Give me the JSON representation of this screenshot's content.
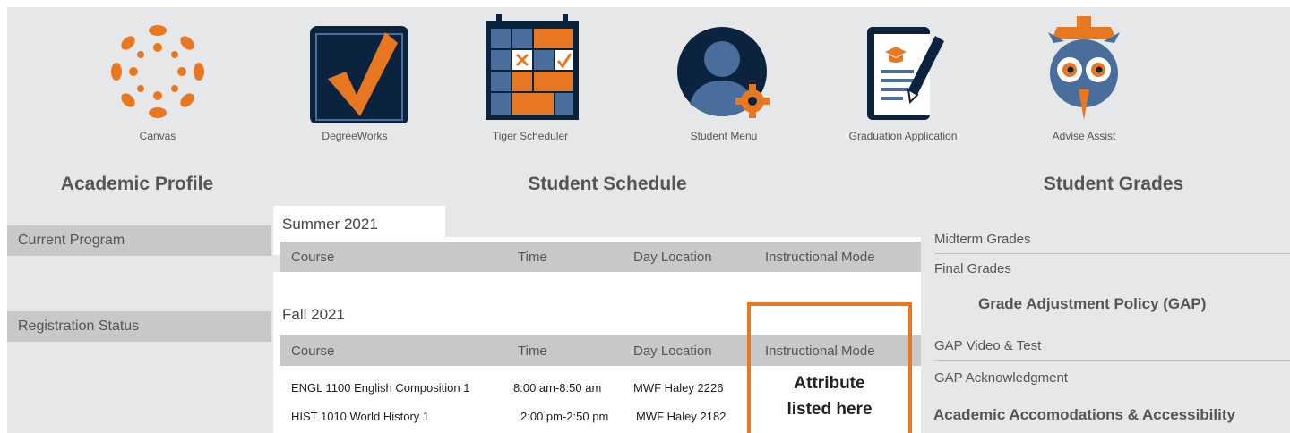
{
  "apps": [
    {
      "label": "Canvas",
      "icon": "canvas-icon"
    },
    {
      "label": "DegreeWorks",
      "icon": "degreeworks-checkmark-icon"
    },
    {
      "label": "Tiger Scheduler",
      "icon": "calendar-scheduler-icon"
    },
    {
      "label": "Student Menu",
      "icon": "student-gear-icon"
    },
    {
      "label": "Graduation Application",
      "icon": "graduation-document-icon"
    },
    {
      "label": "Advise Assist",
      "icon": "owl-icon"
    }
  ],
  "academic_profile": {
    "title": "Academic Profile",
    "items": [
      "Current Program",
      "Registration Status"
    ]
  },
  "schedule": {
    "title": "Student Schedule",
    "columns": [
      "Course",
      "Time",
      "Day Location",
      "Instructional Mode"
    ],
    "terms": [
      {
        "name": "Summer 2021",
        "courses": []
      },
      {
        "name": "Fall 2021",
        "courses": [
          {
            "course": "ENGL 1100 English Composition 1",
            "time": "8:00 am-8:50 am",
            "day_location": "MWF Haley 2226"
          },
          {
            "course": "HIST 1010 World History 1",
            "time": "2:00 pm-2:50 pm",
            "day_location": "MWF Haley 2182"
          }
        ]
      }
    ],
    "callout_line1": "Attribute",
    "callout_line2": "listed here"
  },
  "grades": {
    "title": "Student Grades",
    "links": [
      "Midterm Grades",
      "Final Grades"
    ],
    "gap_title": "Grade Adjustment Policy (GAP)",
    "gap_links": [
      "GAP Video & Test",
      "GAP Acknowledgment"
    ],
    "accommodations_title": "Academic Accomodations & Accessibility"
  },
  "colors": {
    "accent_orange": "#e87722",
    "navy": "#0c2340",
    "steel_blue": "#496e9c",
    "panel_bg": "#e6e7e8",
    "header_gray": "#c8c8c8"
  }
}
